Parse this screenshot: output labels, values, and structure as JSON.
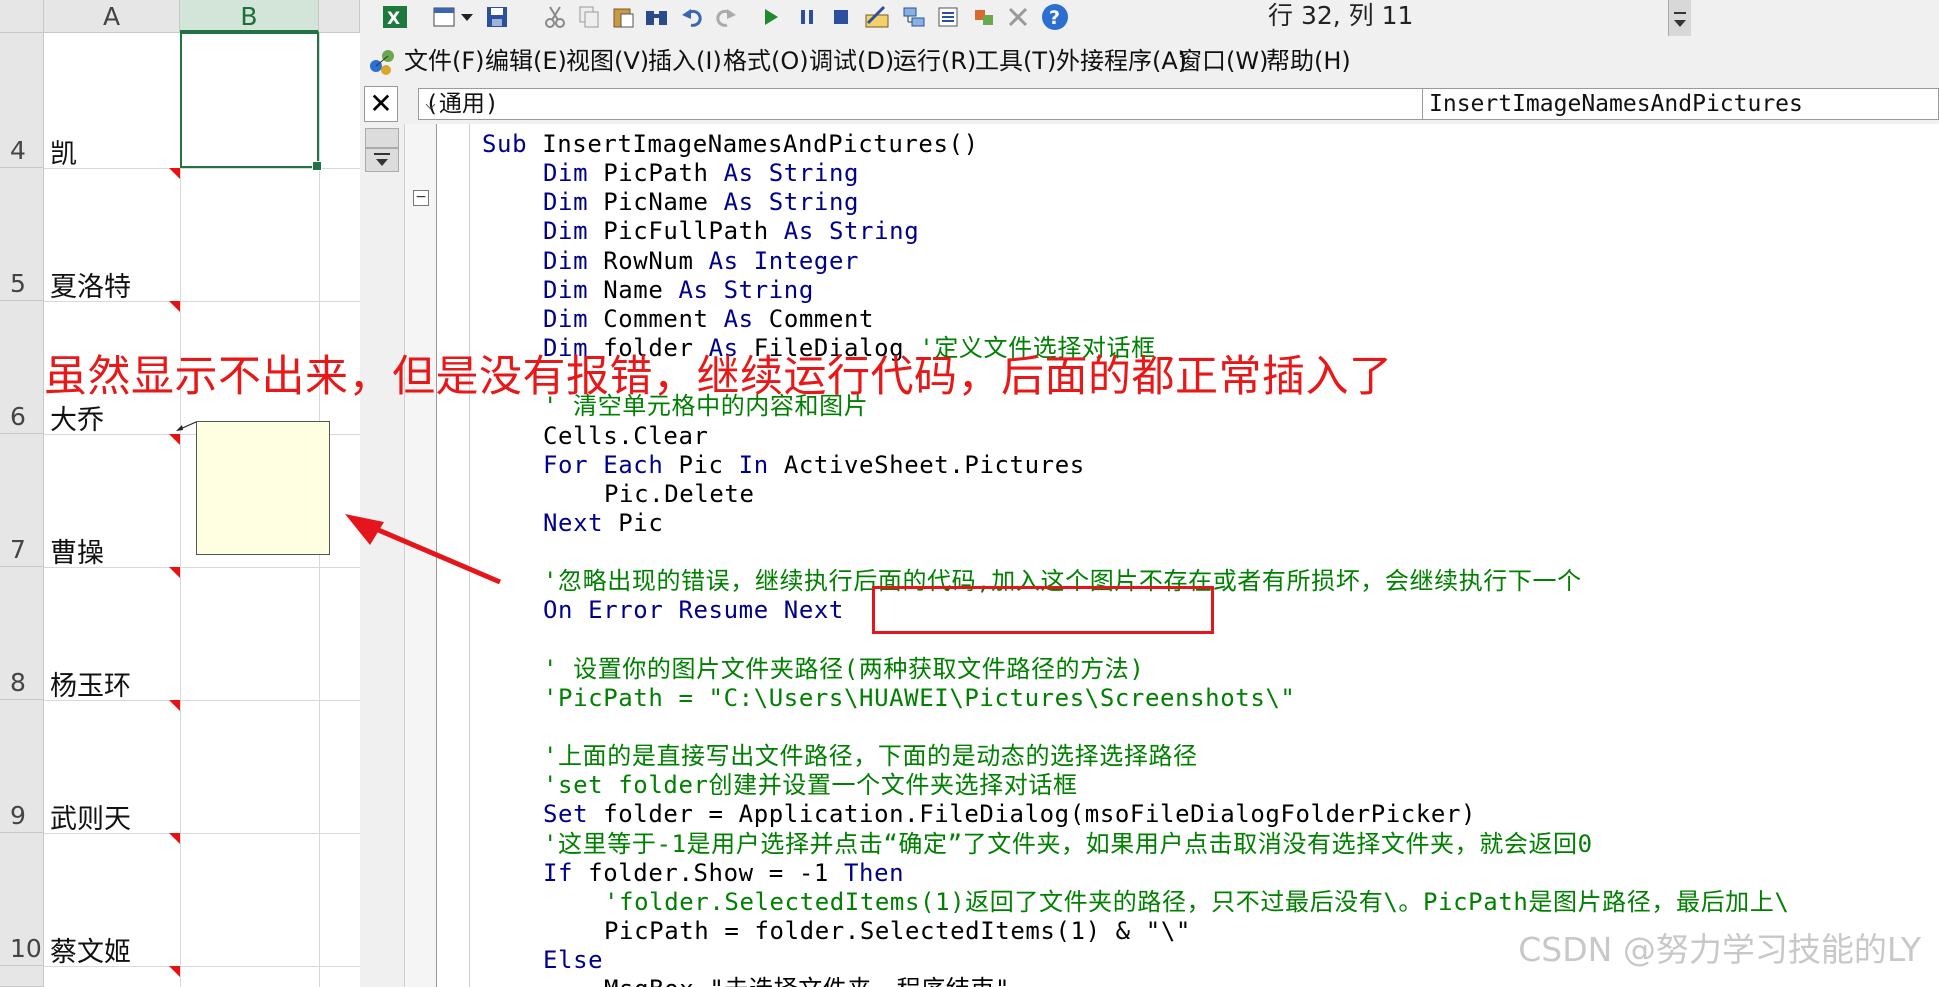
{
  "excel": {
    "columns": [
      "A",
      "B"
    ],
    "rows": [
      {
        "num": "4",
        "name": "凯"
      },
      {
        "num": "5",
        "name": "夏洛特"
      },
      {
        "num": "6",
        "name": "大乔"
      },
      {
        "num": "7",
        "name": "曹操"
      },
      {
        "num": "8",
        "name": "杨玉环"
      },
      {
        "num": "9",
        "name": "武则天"
      },
      {
        "num": "10",
        "name": "蔡文姬"
      }
    ]
  },
  "vbe": {
    "toolbar": {
      "icons": [
        "excel-icon",
        "insert-module-icon",
        "dropdown-arrow-icon",
        "save-icon",
        "cut-icon",
        "copy-icon",
        "paste-icon",
        "find-icon",
        "undo-icon",
        "redo-icon",
        "run-icon",
        "break-icon",
        "reset-icon",
        "design-mode-icon",
        "project-explorer-icon",
        "properties-icon",
        "object-browser-icon",
        "toolbox-icon",
        "help-icon"
      ],
      "position": "行 32, 列 11"
    },
    "menu": [
      "文件(F)",
      "编辑(E)",
      "视图(V)",
      "插入(I)",
      "格式(O)",
      "调试(D)",
      "运行(R)",
      "工具(T)",
      "外接程序(A)",
      "窗口(W)",
      "帮助(H)"
    ],
    "object_combo": "(通用)",
    "proc_combo": "InsertImageNamesAndPictures",
    "code": [
      {
        "indent": 0,
        "parts": [
          {
            "t": "Sub ",
            "c": "kw"
          },
          {
            "t": "InsertImageNamesAndPictures()",
            "c": "tx"
          }
        ]
      },
      {
        "indent": 1,
        "parts": [
          {
            "t": "Dim ",
            "c": "kw"
          },
          {
            "t": "PicPath ",
            "c": "tx"
          },
          {
            "t": "As String",
            "c": "kw"
          }
        ]
      },
      {
        "indent": 1,
        "parts": [
          {
            "t": "Dim ",
            "c": "kw"
          },
          {
            "t": "PicName ",
            "c": "tx"
          },
          {
            "t": "As String",
            "c": "kw"
          }
        ]
      },
      {
        "indent": 1,
        "parts": [
          {
            "t": "Dim ",
            "c": "kw"
          },
          {
            "t": "PicFullPath ",
            "c": "tx"
          },
          {
            "t": "As String",
            "c": "kw"
          }
        ]
      },
      {
        "indent": 1,
        "parts": [
          {
            "t": "Dim ",
            "c": "kw"
          },
          {
            "t": "RowNum ",
            "c": "tx"
          },
          {
            "t": "As Integer",
            "c": "kw"
          }
        ]
      },
      {
        "indent": 1,
        "parts": [
          {
            "t": "Dim ",
            "c": "kw"
          },
          {
            "t": "Name ",
            "c": "tx"
          },
          {
            "t": "As String",
            "c": "kw"
          }
        ]
      },
      {
        "indent": 1,
        "parts": [
          {
            "t": "Dim ",
            "c": "kw"
          },
          {
            "t": "Comment ",
            "c": "tx"
          },
          {
            "t": "As ",
            "c": "kw"
          },
          {
            "t": "Comment",
            "c": "tx"
          }
        ]
      },
      {
        "indent": 1,
        "parts": [
          {
            "t": "Dim ",
            "c": "kw"
          },
          {
            "t": "folder ",
            "c": "tx"
          },
          {
            "t": "As ",
            "c": "kw"
          },
          {
            "t": "FileDialog ",
            "c": "tx"
          },
          {
            "t": "'定义文件选择对话框",
            "c": "cm"
          }
        ]
      },
      {
        "indent": 0,
        "parts": []
      },
      {
        "indent": 1,
        "parts": [
          {
            "t": "' 清空单元格中的内容和图片",
            "c": "cm"
          }
        ]
      },
      {
        "indent": 1,
        "parts": [
          {
            "t": "Cells.Clear",
            "c": "tx"
          }
        ]
      },
      {
        "indent": 1,
        "parts": [
          {
            "t": "For Each ",
            "c": "kw"
          },
          {
            "t": "Pic ",
            "c": "tx"
          },
          {
            "t": "In ",
            "c": "kw"
          },
          {
            "t": "ActiveSheet.Pictures",
            "c": "tx"
          }
        ]
      },
      {
        "indent": 2,
        "parts": [
          {
            "t": "Pic.Delete",
            "c": "tx"
          }
        ]
      },
      {
        "indent": 1,
        "parts": [
          {
            "t": "Next ",
            "c": "kw"
          },
          {
            "t": "Pic",
            "c": "tx"
          }
        ]
      },
      {
        "indent": 0,
        "parts": []
      },
      {
        "indent": 1,
        "parts": [
          {
            "t": "'忽略出现的错误，继续执行后面的代码,加入这个图片不存在或者有所损坏，会继续执行下一个",
            "c": "cm"
          }
        ]
      },
      {
        "indent": 1,
        "parts": [
          {
            "t": "On Error Resume Next",
            "c": "kw"
          }
        ]
      },
      {
        "indent": 0,
        "parts": []
      },
      {
        "indent": 1,
        "parts": [
          {
            "t": "' 设置你的图片文件夹路径(两种获取文件路径的方法)",
            "c": "cm"
          }
        ]
      },
      {
        "indent": 1,
        "parts": [
          {
            "t": "'PicPath = \"C:\\Users\\HUAWEI\\Pictures\\Screenshots\\\"",
            "c": "cm"
          }
        ]
      },
      {
        "indent": 0,
        "parts": []
      },
      {
        "indent": 1,
        "parts": [
          {
            "t": "'上面的是直接写出文件路径，下面的是动态的选择选择路径",
            "c": "cm"
          }
        ]
      },
      {
        "indent": 1,
        "parts": [
          {
            "t": "'set folder创建并设置一个文件夹选择对话框",
            "c": "cm"
          }
        ]
      },
      {
        "indent": 1,
        "parts": [
          {
            "t": "Set ",
            "c": "kw"
          },
          {
            "t": "folder = Application.FileDialog(msoFileDialogFolderPicker)",
            "c": "tx"
          }
        ]
      },
      {
        "indent": 1,
        "parts": [
          {
            "t": "'这里等于-1是用户选择并点击“确定”了文件夹，如果用户点击取消没有选择文件夹，就会返回0",
            "c": "cm"
          }
        ]
      },
      {
        "indent": 1,
        "parts": [
          {
            "t": "If ",
            "c": "kw"
          },
          {
            "t": "folder.Show = -1 ",
            "c": "tx"
          },
          {
            "t": "Then",
            "c": "kw"
          }
        ]
      },
      {
        "indent": 2,
        "parts": [
          {
            "t": "'folder.SelectedItems(1)返回了文件夹的路径，只不过最后没有\\。PicPath是图片路径，最后加上\\",
            "c": "cm"
          }
        ]
      },
      {
        "indent": 2,
        "parts": [
          {
            "t": "PicPath = folder.SelectedItems(1) & \"\\\"",
            "c": "tx"
          }
        ]
      },
      {
        "indent": 1,
        "parts": [
          {
            "t": "Else",
            "c": "kw"
          }
        ]
      },
      {
        "indent": 2,
        "parts": [
          {
            "t": "MsgBox \"未选择文件夹，程序结束\"",
            "c": "tx"
          }
        ]
      }
    ]
  },
  "annotation": "虽然显示不出来，但是没有报错，继续运行代码，后面的都正常插入了",
  "watermark": "CSDN @努力学习技能的LY",
  "colors": {
    "accent_red": "#e4161b",
    "keyword": "#00008b",
    "comment": "#008000",
    "excel_green": "#217346"
  }
}
